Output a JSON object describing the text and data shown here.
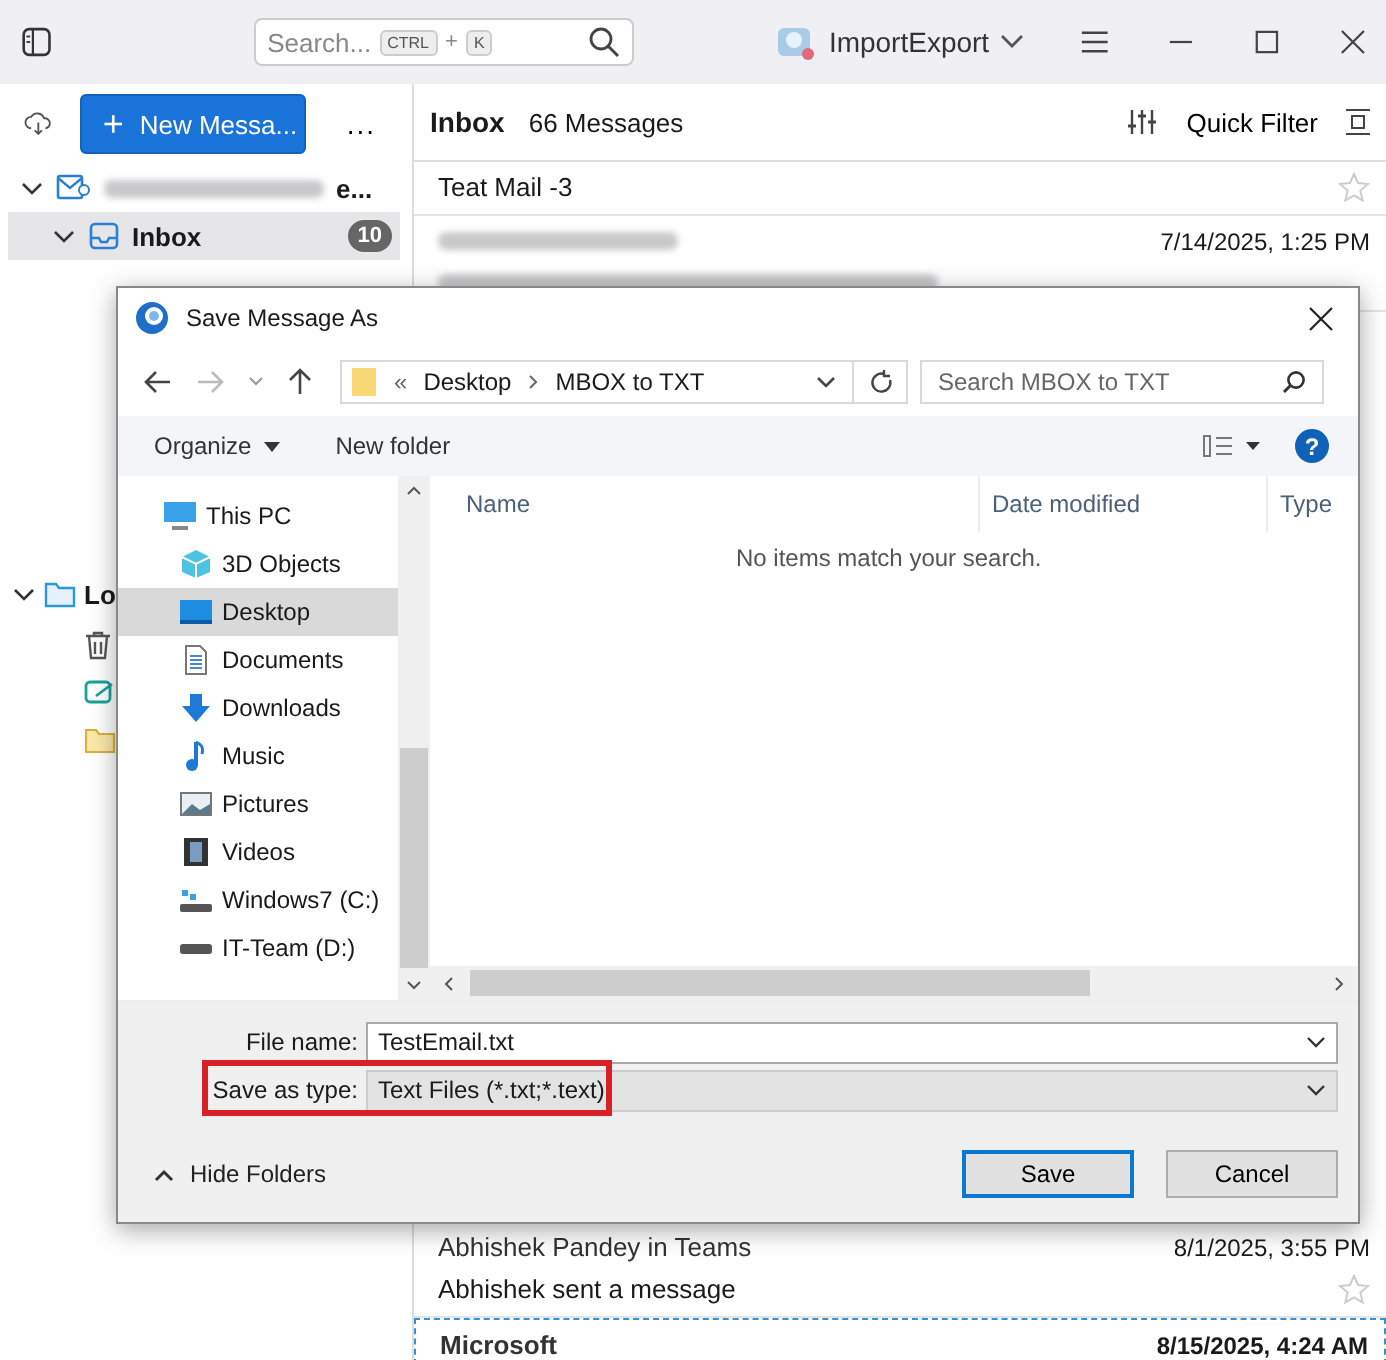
{
  "top_bar": {
    "search_placeholder": "Search...",
    "shortcut_keys": [
      "CTRL",
      "K"
    ],
    "shortcut_joiner": "+",
    "account": "ImportExport"
  },
  "sidebar": {
    "new_message_plus": "+",
    "new_message": "New Messa...",
    "more": "...",
    "folders": [
      {
        "kind": "account",
        "label_tail": "e...",
        "expanded": true,
        "selected": false
      },
      {
        "kind": "inbox",
        "label": "Inbox",
        "count": "10",
        "expanded": true,
        "selected": true
      },
      {
        "kind": "local",
        "label": "Lo",
        "expanded": true,
        "selected": false
      }
    ]
  },
  "message_list": {
    "title": "Inbox",
    "count": "66 Messages",
    "quick_filter": "Quick Filter",
    "top_messages": [
      {
        "subject": "Teat Mail -3"
      },
      {
        "date": "7/14/2025, 1:25 PM"
      }
    ],
    "bottom_messages": [
      {
        "sender": "Abhishek Pandey in Teams",
        "date": "8/1/2025, 3:55 PM",
        "subject": "Abhishek sent a message",
        "unread": false,
        "selected": false
      },
      {
        "sender": "Microsoft",
        "date": "8/15/2025, 4:24 AM",
        "unread": true,
        "selected": true
      }
    ]
  },
  "dialog": {
    "title": "Save Message As",
    "breadcrumb_prefix": "«",
    "breadcrumb": [
      "Desktop",
      "MBOX to TXT"
    ],
    "search_placeholder": "Search MBOX to TXT",
    "organize": "Organize",
    "new_folder": "New folder",
    "help_symbol": "?",
    "nav_items": [
      {
        "kind": "pc",
        "label": "This PC",
        "selected": false
      },
      {
        "kind": "objects3d",
        "label": "3D Objects",
        "selected": false
      },
      {
        "kind": "desktop",
        "label": "Desktop",
        "selected": true
      },
      {
        "kind": "documents",
        "label": "Documents",
        "selected": false
      },
      {
        "kind": "downloads",
        "label": "Downloads",
        "selected": false
      },
      {
        "kind": "music",
        "label": "Music",
        "selected": false
      },
      {
        "kind": "pictures",
        "label": "Pictures",
        "selected": false
      },
      {
        "kind": "videos",
        "label": "Videos",
        "selected": false
      },
      {
        "kind": "drive_c",
        "label": "Windows7 (C:)",
        "selected": false
      },
      {
        "kind": "drive",
        "label": "IT-Team (D:)",
        "selected": false
      }
    ],
    "columns": [
      "Name",
      "Date modified",
      "Type"
    ],
    "empty_message": "No items match your search.",
    "file_name_label": "File name:",
    "file_name_value": "TestEmail.txt",
    "type_label": "Save as type:",
    "type_value": "Text Files (*.txt;*.text)",
    "type_highlighted": true,
    "hide_folders": "Hide Folders",
    "buttons": [
      {
        "label": "Save",
        "default": true
      },
      {
        "label": "Cancel",
        "default": false
      }
    ]
  }
}
